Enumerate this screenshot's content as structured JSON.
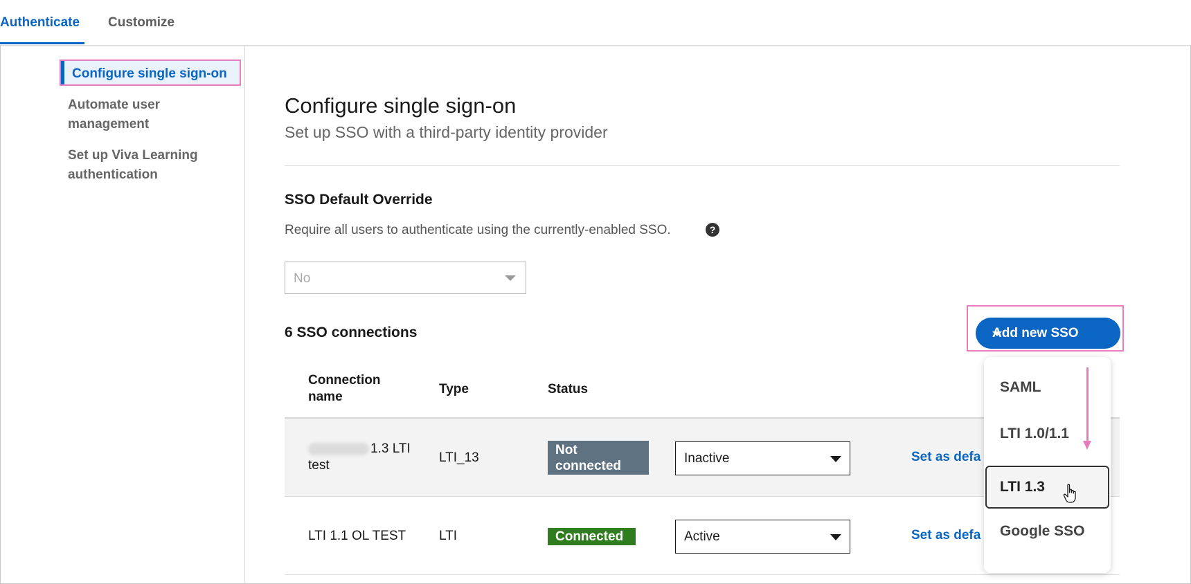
{
  "tabs": {
    "authenticate": "Authenticate",
    "customize": "Customize"
  },
  "sidebar": {
    "items": [
      {
        "label": "Configure single sign-on",
        "active": true
      },
      {
        "label": "Automate user management",
        "active": false
      },
      {
        "label": "Set up Viva Learning authentication",
        "active": false
      }
    ]
  },
  "main": {
    "title": "Configure single sign-on",
    "subtitle": "Set up SSO with a third-party identity provider"
  },
  "override": {
    "title": "SSO Default Override",
    "description": "Require all users to authenticate using the currently-enabled SSO.",
    "selected": "No"
  },
  "connections": {
    "count_label": "6 SSO connections",
    "add_button": "Add new SSO",
    "columns": [
      "Connection name",
      "Type",
      "Status"
    ],
    "rows": [
      {
        "name": "1.3 LTI test",
        "name_prefix_redacted": true,
        "type": "LTI_13",
        "status": "Not connected",
        "state": "Inactive",
        "action": "Set as defa"
      },
      {
        "name": "LTI 1.1 OL TEST",
        "name_prefix_redacted": false,
        "type": "LTI",
        "status": "Connected",
        "state": "Active",
        "action": "Set as defa"
      }
    ]
  },
  "add_menu": {
    "options": [
      "SAML",
      "LTI 1.0/1.1",
      "LTI 1.3",
      "Google SSO"
    ],
    "hovered": "LTI 1.3"
  },
  "colors": {
    "accent": "#0a66c2",
    "highlight": "#e87cbd",
    "not_connected_badge": "#5f7282",
    "connected_badge": "#2f7d1f"
  }
}
